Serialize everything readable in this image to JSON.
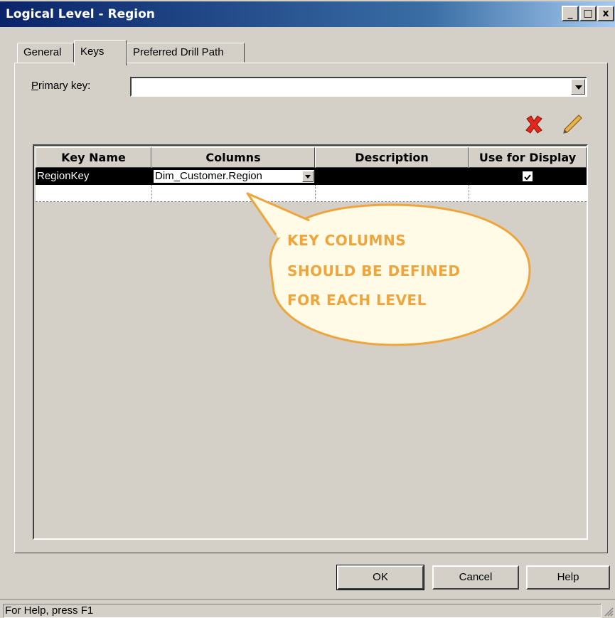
{
  "window": {
    "title": "Logical Level - Region",
    "controls": {
      "minimize": "_",
      "maximize": "□",
      "close": "x"
    }
  },
  "tabs": [
    {
      "label": "General"
    },
    {
      "label": "Keys",
      "active": true
    },
    {
      "label": "Preferred Drill Path"
    }
  ],
  "primary_key": {
    "label_prefix": "P",
    "label_rest": "rimary key:",
    "value": ""
  },
  "toolbar": {
    "delete_icon": "red-x-delete-icon",
    "edit_icon": "pencil-edit-icon"
  },
  "grid": {
    "columns": [
      "Key Name",
      "Columns",
      "Description",
      "Use for Display"
    ],
    "rows": [
      {
        "key_name": "RegionKey",
        "columns": "Dim_Customer.Region",
        "description": "",
        "use_for_display": true
      },
      {
        "key_name": "",
        "columns": "",
        "description": "",
        "use_for_display": false
      }
    ]
  },
  "callout": {
    "line1": "KEY COLUMNS",
    "line2": "SHOULD BE DEFINED",
    "line3": "FOR EACH LEVEL",
    "color": "#f0a53c"
  },
  "buttons": {
    "ok": "OK",
    "cancel": "Cancel",
    "help": "Help"
  },
  "status": {
    "text": "For Help, press F1"
  }
}
